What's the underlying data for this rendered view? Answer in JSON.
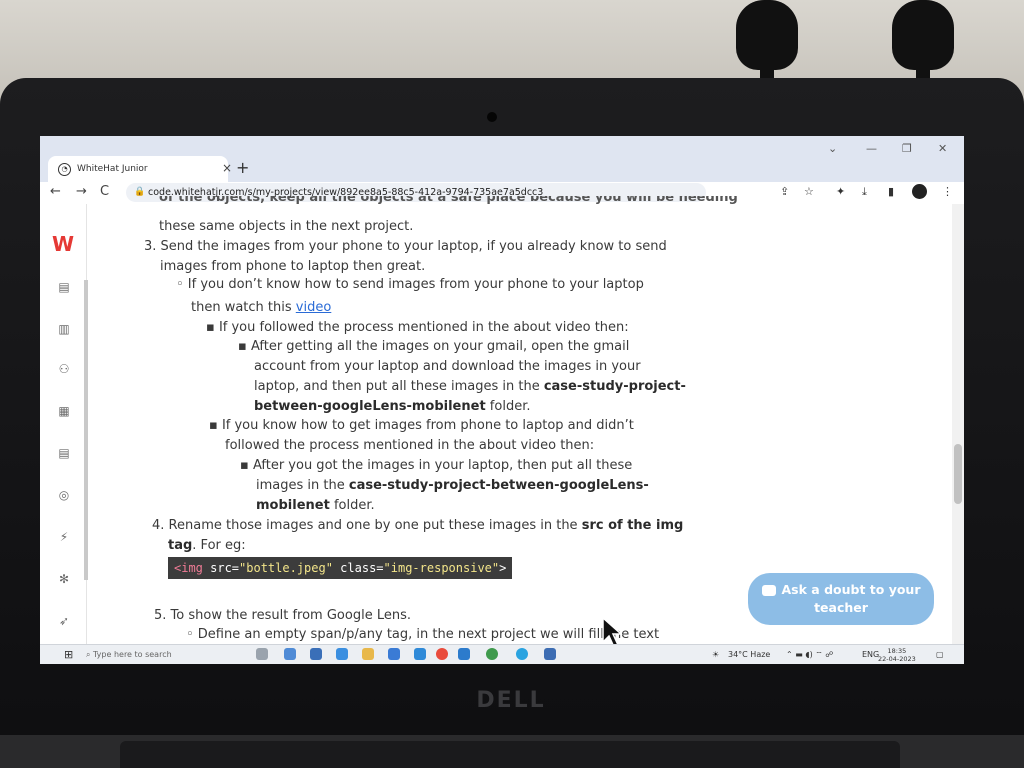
{
  "browser": {
    "tab_title": "WhiteHat Junior",
    "tab_close": "×",
    "new_tab": "+",
    "url": "code.whitehatjr.com/s/my-projects/view/892ee8a5-88c5-412a-9794-735ae7a5dcc3"
  },
  "content": {
    "cut_top_line": "of the objects, keep all the objects at a safe place because you will be needing",
    "line_same_objects": "these same objects in the next project.",
    "step3_line1": "3. Send the images from your phone to your laptop, if you already know to send",
    "step3_line2": "images from phone to laptop then great.",
    "sub1_line1": "◦  If you don’t know how to send images from your phone to your laptop",
    "sub1_line2_prefix": "then watch this ",
    "sub1_link": "video",
    "sub1a_line1": "▪  If you followed the process mentioned in the about video then:",
    "sub1a_i_line1": "▪  After getting all the images on your gmail, open the gmail",
    "sub1a_i_line2": "account from your laptop and download the images in your",
    "sub1a_i_line3_prefix": "laptop, and then put all these images in the ",
    "sub1a_i_line3_bold": "case-study-project-",
    "sub1a_i_line4_bold": "between-googleLens-mobilenet",
    "sub1a_i_line4_suffix": " folder.",
    "sub1b_line1": "▪  If you know how to get images from phone to laptop and didn’t",
    "sub1b_line2": "followed the process mentioned in the about video then:",
    "sub1b_i_line1": "▪  After you got the images in your laptop, then put all these",
    "sub1b_i_line2_prefix": "images in the ",
    "sub1b_i_line2_bold": "case-study-project-between-googleLens-",
    "sub1b_i_line3_bold": "mobilenet",
    "sub1b_i_line3_suffix": " folder.",
    "step4_line1_prefix": "4. Rename those images and one by one put these images in the ",
    "step4_line1_bold": "src of the img",
    "step4_line2_bold": "tag",
    "step4_line2_suffix": ". For eg:",
    "code_tag_open": "<img",
    "code_attr1": " src=",
    "code_val1": "\"bottle.jpeg\"",
    "code_attr2": " class=",
    "code_val2": "\"img-responsive\"",
    "code_close": ">",
    "step5_line1": "5. To show the result from Google Lens.",
    "step5_sub1": "◦  Define an empty span/p/any tag, in the next project we will fill the text"
  },
  "ask_doubt": {
    "line1": "Ask a doubt to your",
    "line2": "teacher"
  },
  "taskbar": {
    "search_placeholder": "Type here to search",
    "weather": "34°C  Haze",
    "lang": "ENG",
    "time": "18:35",
    "date": "22-04-2023"
  },
  "photo": {
    "brand": "DELL"
  }
}
